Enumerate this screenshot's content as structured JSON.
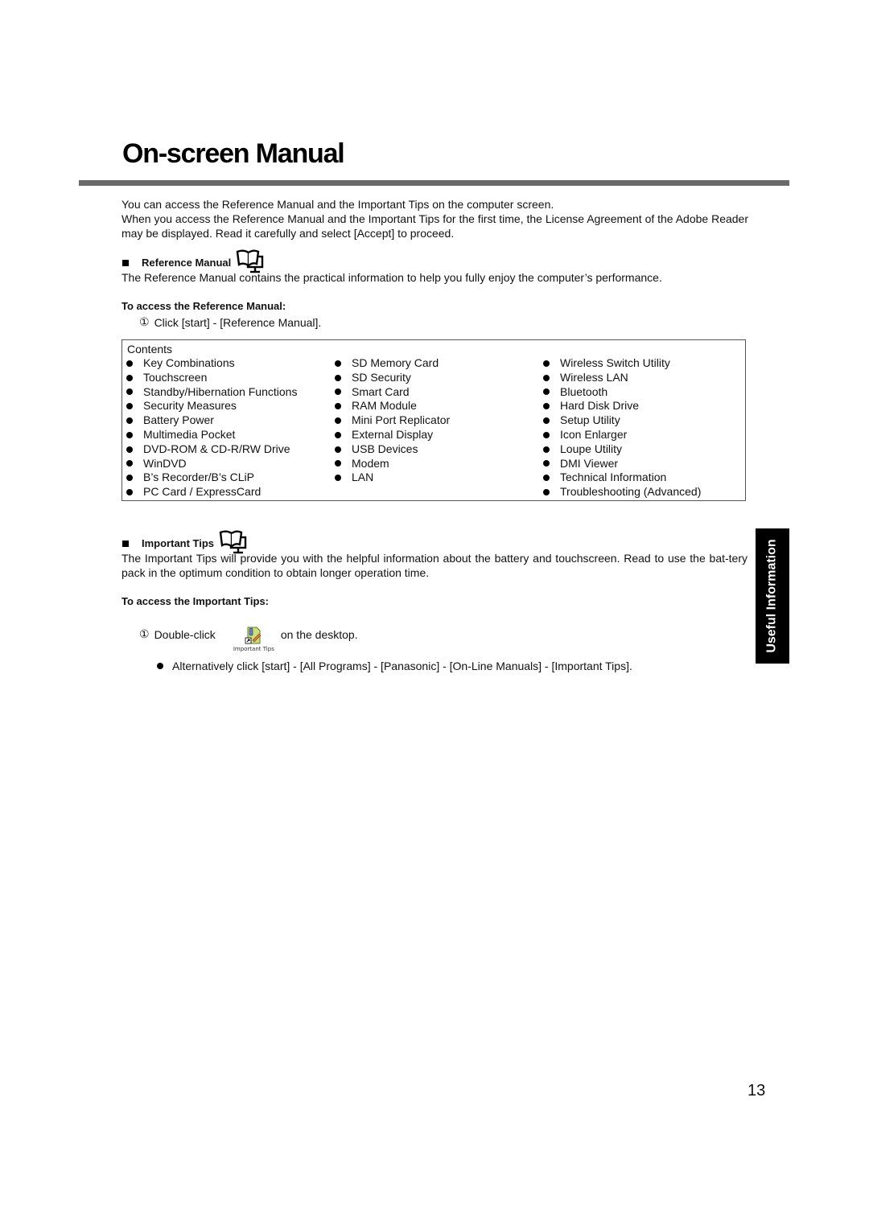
{
  "page": {
    "title": "On-screen Manual",
    "side_tab": "Useful Information",
    "page_number": "13"
  },
  "intro": {
    "line1": "You can access the Reference Manual and the Important Tips on the computer screen.",
    "line2": "When you access the Reference Manual and the Important Tips for the first time, the License Agreement of the Adobe Reader may be displayed. Read it carefully and select [Accept] to proceed."
  },
  "reference_manual": {
    "heading": "Reference Manual",
    "icon": "book-monitor-icon",
    "description": "The Reference Manual contains the practical information to help you fully enjoy the computer’s performance.",
    "access_heading": "To access the Reference Manual:",
    "step_number": "①",
    "step_text": "Click [start] - [Reference Manual].",
    "contents_label": "Contents",
    "contents_columns": [
      [
        "Key Combinations",
        "Touchscreen",
        "Standby/Hibernation Functions",
        "Security Measures",
        "Battery Power",
        "Multimedia Pocket",
        "DVD-ROM & CD-R/RW Drive",
        "WinDVD",
        "B’s Recorder/B’s CLiP",
        "PC Card / ExpressCard"
      ],
      [
        "SD Memory Card",
        "SD Security",
        "Smart Card",
        "RAM Module",
        "Mini Port Replicator",
        "External Display",
        "USB Devices",
        "Modem",
        "LAN"
      ],
      [
        "Wireless Switch Utility",
        "Wireless LAN",
        "Bluetooth",
        "Hard Disk Drive",
        "Setup Utility",
        "Icon Enlarger",
        "Loupe Utility",
        "DMI Viewer",
        "Technical Information",
        "Troubleshooting (Advanced)"
      ]
    ]
  },
  "important_tips": {
    "heading": "Important Tips",
    "icon": "book-monitor-icon",
    "description": "The Important Tips will provide you with the helpful information about the battery and touchscreen. Read to use the bat-tery pack in the optimum condition to obtain longer operation time.",
    "access_heading": "To access the Important Tips:",
    "step_number": "①",
    "step_prefix": "Double-click",
    "desktop_icon_caption": "Important Tips",
    "step_suffix": "on the desktop.",
    "alternative": "Alternatively click [start] - [All Programs] - [Panasonic] - [On-Line Manuals] - [Important Tips]."
  }
}
